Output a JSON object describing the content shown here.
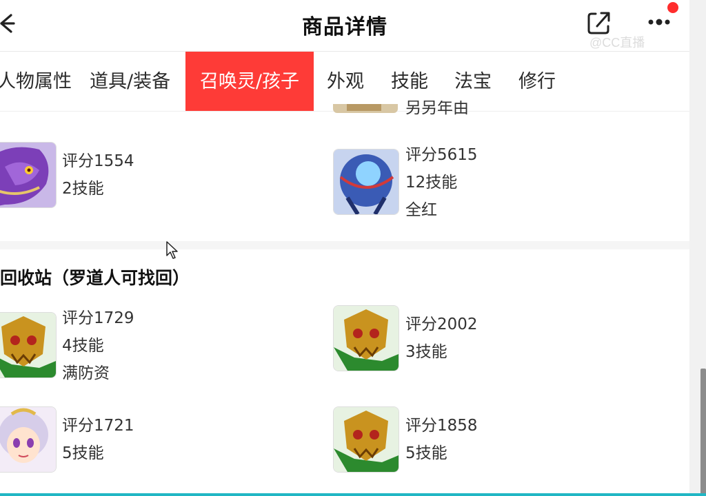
{
  "header": {
    "title": "商品详情",
    "back_icon": "back-arrow-icon",
    "share_icon": "share-icon",
    "more_icon": "more-icon",
    "watermark": "@CC直播"
  },
  "tabs": [
    {
      "label": "人物属性",
      "active": false
    },
    {
      "label": "道具/装备",
      "active": false
    },
    {
      "label": "召唤灵/孩子",
      "active": true
    },
    {
      "label": "外观",
      "active": false
    },
    {
      "label": "技能",
      "active": false
    },
    {
      "label": "法宝",
      "active": false
    },
    {
      "label": "修行",
      "active": false
    }
  ],
  "colors": {
    "accent": "#fe3b37",
    "notify": "#ff2d2d",
    "bottom": "#21b6c4"
  },
  "partial_row": {
    "text": "另另年由"
  },
  "summons": [
    {
      "lines": [
        "评分1554",
        "2技能"
      ],
      "icon": "purple-dragon-avatar"
    },
    {
      "lines": [
        "评分5615",
        "12技能",
        "全红"
      ],
      "icon": "blue-armor-avatar"
    }
  ],
  "recycle": {
    "title": "回收站（罗道人可找回）",
    "items": [
      {
        "lines": [
          "评分1729",
          "4技能",
          "满防资"
        ],
        "icon": "golden-mask-avatar"
      },
      {
        "lines": [
          "评分2002",
          "3技能"
        ],
        "icon": "golden-mask-avatar"
      },
      {
        "lines": [
          "评分1721",
          "5技能"
        ],
        "icon": "fairy-girl-avatar"
      },
      {
        "lines": [
          "评分1858",
          "5技能"
        ],
        "icon": "golden-mask-avatar"
      }
    ]
  }
}
